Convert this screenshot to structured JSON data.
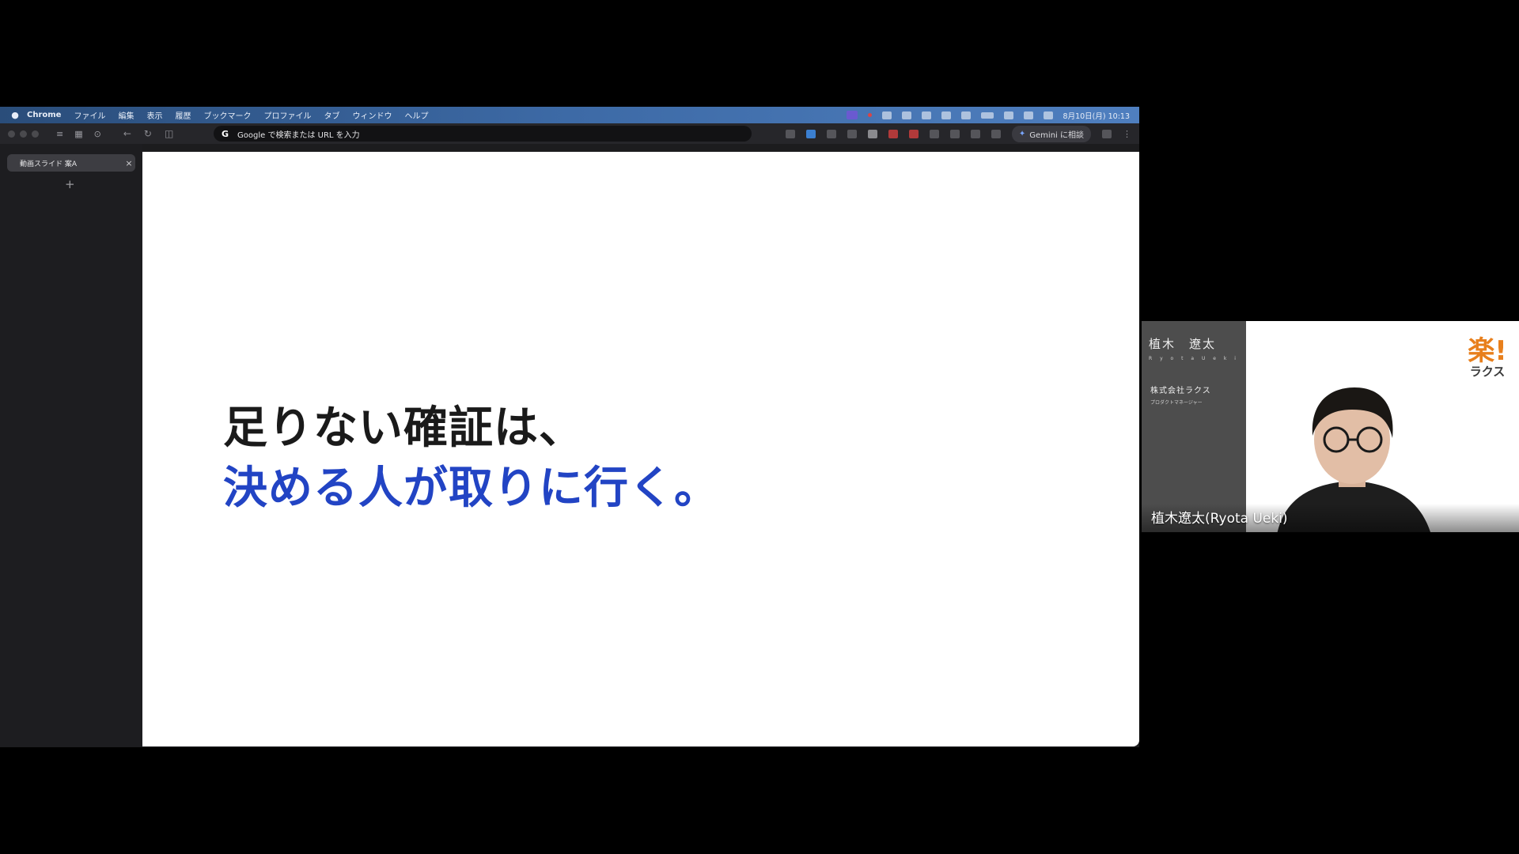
{
  "menubar": {
    "items": [
      "Chrome",
      "ファイル",
      "編集",
      "表示",
      "履歴",
      "ブックマーク",
      "プロファイル",
      "タブ",
      "ウィンドウ",
      "ヘルプ"
    ],
    "clock": "8月10日(月) 10:13"
  },
  "browser": {
    "omnibox_placeholder": "Google で検索または URL を入力",
    "omnibox_icon": "G",
    "gemini_label": "Gemini に相談",
    "tab_title": "動画スライド 案A",
    "tab_close": "×",
    "new_tab": "+"
  },
  "slide": {
    "line1": "足りない確証は、",
    "line2": "決める人が取りに行く。",
    "line2_color": "#2244c4"
  },
  "video": {
    "nameplate_name": "植木　遼太",
    "nameplate_romaji": "R y o t a   U e k i",
    "company": "株式会社ラクス",
    "role": "プロダクトマネージャー",
    "logo_kanji": "楽!",
    "logo_kana": "ラクス",
    "logo_color": "#e87f1c",
    "participant_name": "植木遼太(Ryota Ueki)"
  }
}
